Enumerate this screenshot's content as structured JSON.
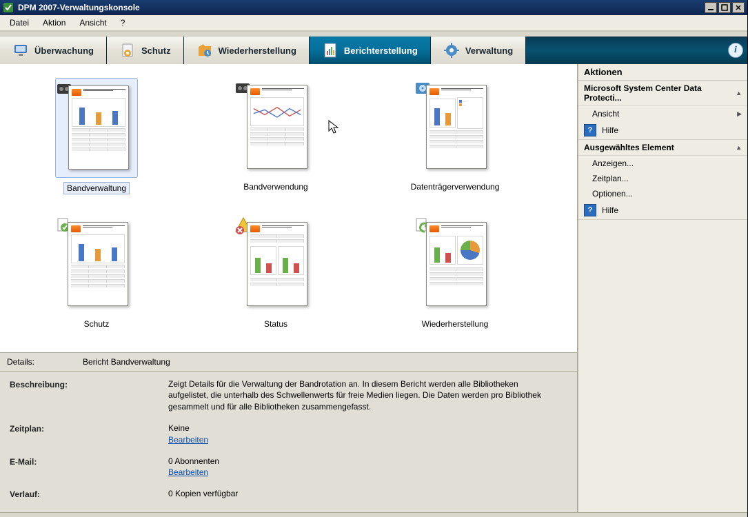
{
  "window": {
    "title": "DPM 2007-Verwaltungskonsole"
  },
  "menubar": {
    "items": [
      "Datei",
      "Aktion",
      "Ansicht",
      "?"
    ]
  },
  "nav": {
    "tabs": [
      {
        "label": "Überwachung"
      },
      {
        "label": "Schutz"
      },
      {
        "label": "Wiederherstellung"
      },
      {
        "label": "Berichterstellung"
      },
      {
        "label": "Verwaltung"
      }
    ]
  },
  "reports": [
    {
      "label": "Bandverwaltung",
      "selected": true
    },
    {
      "label": "Bandverwendung"
    },
    {
      "label": "Datenträgerverwendung"
    },
    {
      "label": "Schutz"
    },
    {
      "label": "Status"
    },
    {
      "label": "Wiederherstellung"
    }
  ],
  "details_summary": {
    "label": "Details:",
    "value": "Bericht Bandverwaltung"
  },
  "details": {
    "description_label": "Beschreibung:",
    "description": "Zeigt Details für die Verwaltung der Bandrotation an. In diesem Bericht werden alle Bibliotheken aufgelistet, die unterhalb des Schwellenwerts für freie Medien liegen. Die Daten werden pro Bibliothek gesammelt und für alle Bibliotheken zusammengefasst.",
    "schedule_label": "Zeitplan:",
    "schedule_value": "Keine",
    "schedule_link": "Bearbeiten",
    "email_label": "E-Mail:",
    "email_value": "0 Abonnenten",
    "email_link": "Bearbeiten",
    "history_label": "Verlauf:",
    "history_value": "0 Kopien verfügbar"
  },
  "actions": {
    "title": "Aktionen",
    "section1_title": "Microsoft System Center Data Protecti...",
    "view": "Ansicht",
    "help": "Hilfe",
    "section2_title": "Ausgewähltes Element",
    "items": [
      "Anzeigen...",
      "Zeitplan...",
      "Optionen..."
    ]
  }
}
